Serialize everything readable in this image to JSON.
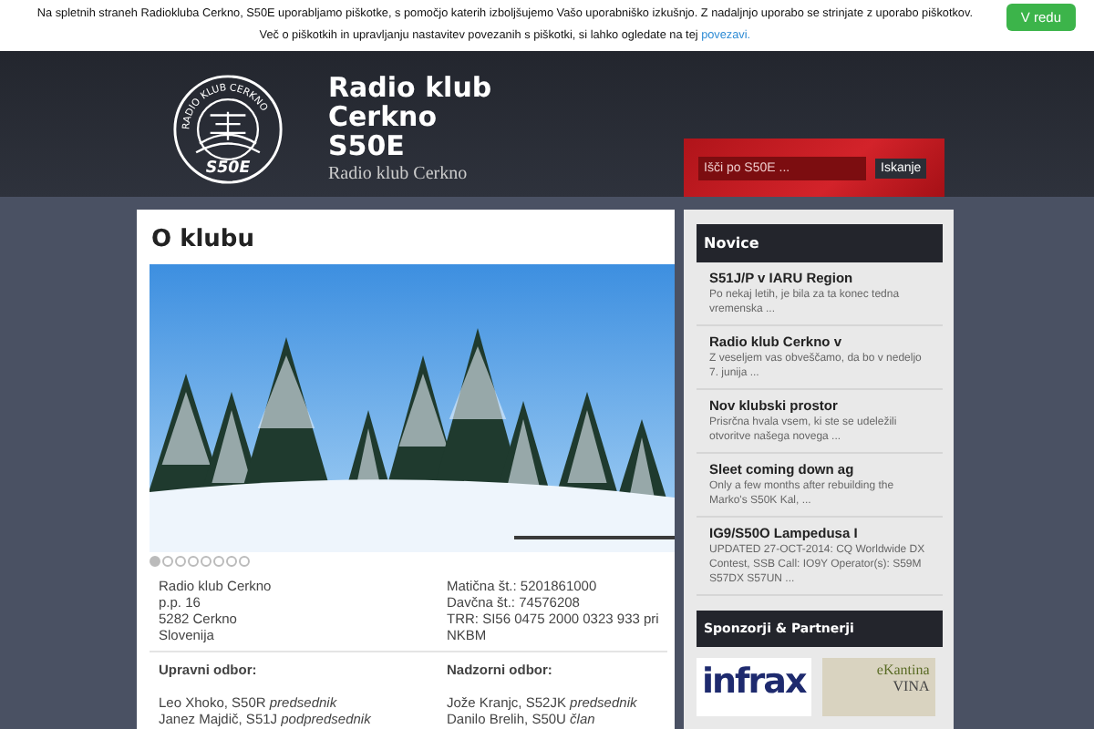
{
  "cookie_notice": {
    "line_1": "Na spletnih straneh Radiokluba Cerkno, S50E uporabljamo piškotke, s pomočjo katerih izboljšujemo Vašo uporabniško izkušnjo. Z nadaljnjo uporabo se strinjate z uporabo piškotkov.",
    "line_2": "Več o piškotkih in upravljanju nastavitev povezanih s piškotki, si lahko ogledate na tej ",
    "link": "povezavi.",
    "button": "V redu"
  },
  "header": {
    "logo_ring": "RADIO KLUB CERKNO",
    "logo_callsign": "S50E",
    "title_lines": [
      "Radio klub",
      "Cerkno",
      "S50E"
    ],
    "tagline": "Radio klub Cerkno"
  },
  "search": {
    "placeholder": "Išči po S50E ...",
    "button": "Iskanje"
  },
  "main": {
    "title": "O klubu",
    "slider_dots": [
      {
        "selected": true
      },
      {
        "selected": false
      },
      {
        "selected": false
      },
      {
        "selected": false
      },
      {
        "selected": false
      },
      {
        "selected": false
      },
      {
        "selected": false
      },
      {
        "selected": false
      }
    ],
    "address": [
      "Radio klub Cerkno",
      "p.p. 16",
      "5282 Cerkno",
      "Slovenija"
    ],
    "registry": [
      "Matična št.: 5201861000",
      "Davčna št.: 74576208",
      "TRR: SI56 0475 2000 0323 933 pri NKBM"
    ],
    "boards": [
      {
        "heading": "Upravni odbor:",
        "members": [
          "Leo Xhoko, S50R *predsednik*",
          "Janez Majdič, S51J *podpredsednik*"
        ]
      },
      {
        "heading": "Nadzorni odbor:",
        "members": [
          "Jože Kranjc, S52JK *predsednik*",
          "Danilo Brelih, S50U *član*"
        ]
      }
    ]
  },
  "sidebar": {
    "news_title": "Novice",
    "news": [
      {
        "title": "S51J/P v IARU Region",
        "excerpt": "Po nekaj letih, je bila za ta konec tedna vremenska ..."
      },
      {
        "title": "Radio klub Cerkno v",
        "excerpt": "Z veseljem vas obveščamo, da bo v nedeljo 7. junija ..."
      },
      {
        "title": "Nov klubski prostor",
        "excerpt": "Prisrčna hvala vsem, ki ste se udeležili otvoritve našega novega ..."
      },
      {
        "title": "Sleet coming down ag",
        "excerpt": "Only a few months after rebuilding the Marko's S50K Kal, ..."
      },
      {
        "title": "IG9/S50O Lampedusa I",
        "excerpt": "UPDATED 27-OCT-2014: CQ Worldwide DX Contest, SSB Call: IO9Y Operator(s): S59M S57DX S57UN ..."
      }
    ],
    "sponsors_title": "Sponzorji & Partnerji",
    "sponsors": [
      {
        "kind": "wordmark",
        "text": "infrax"
      },
      {
        "kind": "photo",
        "text": "eKantina",
        "subtext": "VINA"
      }
    ]
  }
}
